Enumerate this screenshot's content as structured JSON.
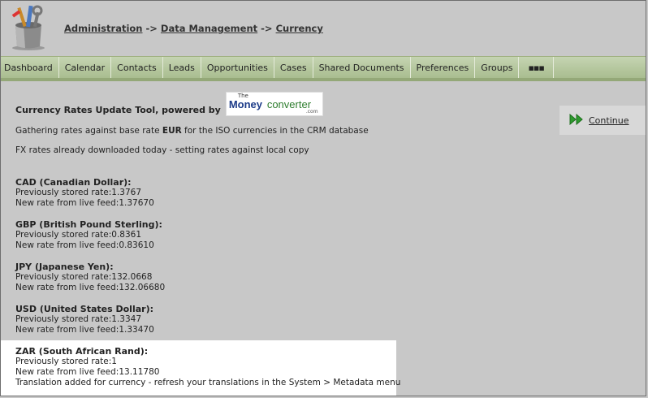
{
  "breadcrumb": {
    "items": [
      "Administration",
      "Data Management",
      "Currency"
    ],
    "separator": "->"
  },
  "nav": {
    "tabs": [
      "Dashboard",
      "Calendar",
      "Contacts",
      "Leads",
      "Opportunities",
      "Cases",
      "Shared Documents",
      "Preferences",
      "Groups",
      "▪▪▪"
    ]
  },
  "main": {
    "title": "Currency Rates Update Tool, powered by",
    "logo": {
      "the": "The",
      "money": "Money",
      "converter": "converter",
      "com": ".com"
    },
    "gathering_prefix": "Gathering rates against base rate ",
    "base_currency": "EUR",
    "gathering_suffix": " for the ISO currencies in the CRM database",
    "fx_note": "FX rates already downloaded today - setting rates against local copy"
  },
  "currencies": [
    {
      "name": "CAD (Canadian Dollar):",
      "stored": "Previously stored rate:1.3767",
      "new": "New rate from live feed:1.37670"
    },
    {
      "name": "GBP (British Pound Sterling):",
      "stored": "Previously stored rate:0.8361",
      "new": "New rate from live feed:0.83610"
    },
    {
      "name": "JPY (Japanese Yen):",
      "stored": "Previously stored rate:132.0668",
      "new": "New rate from live feed:132.06680"
    },
    {
      "name": "USD (United States Dollar):",
      "stored": "Previously stored rate:1.3347",
      "new": "New rate from live feed:1.33470"
    },
    {
      "name": "ZAR (South African Rand):",
      "stored": "Previously stored rate:1",
      "new": "New rate from live feed:13.11780",
      "note": "Translation added for currency - refresh your translations in the System > Metadata menu"
    }
  ],
  "continue_button": {
    "label": "Continue",
    "icon": "fast-forward-icon",
    "icon_color": "#2e9a2e"
  },
  "colors": {
    "nav_bg": "#b4c69d",
    "page_bg": "#c8c8c8",
    "highlight_bg": "#ffffff"
  }
}
